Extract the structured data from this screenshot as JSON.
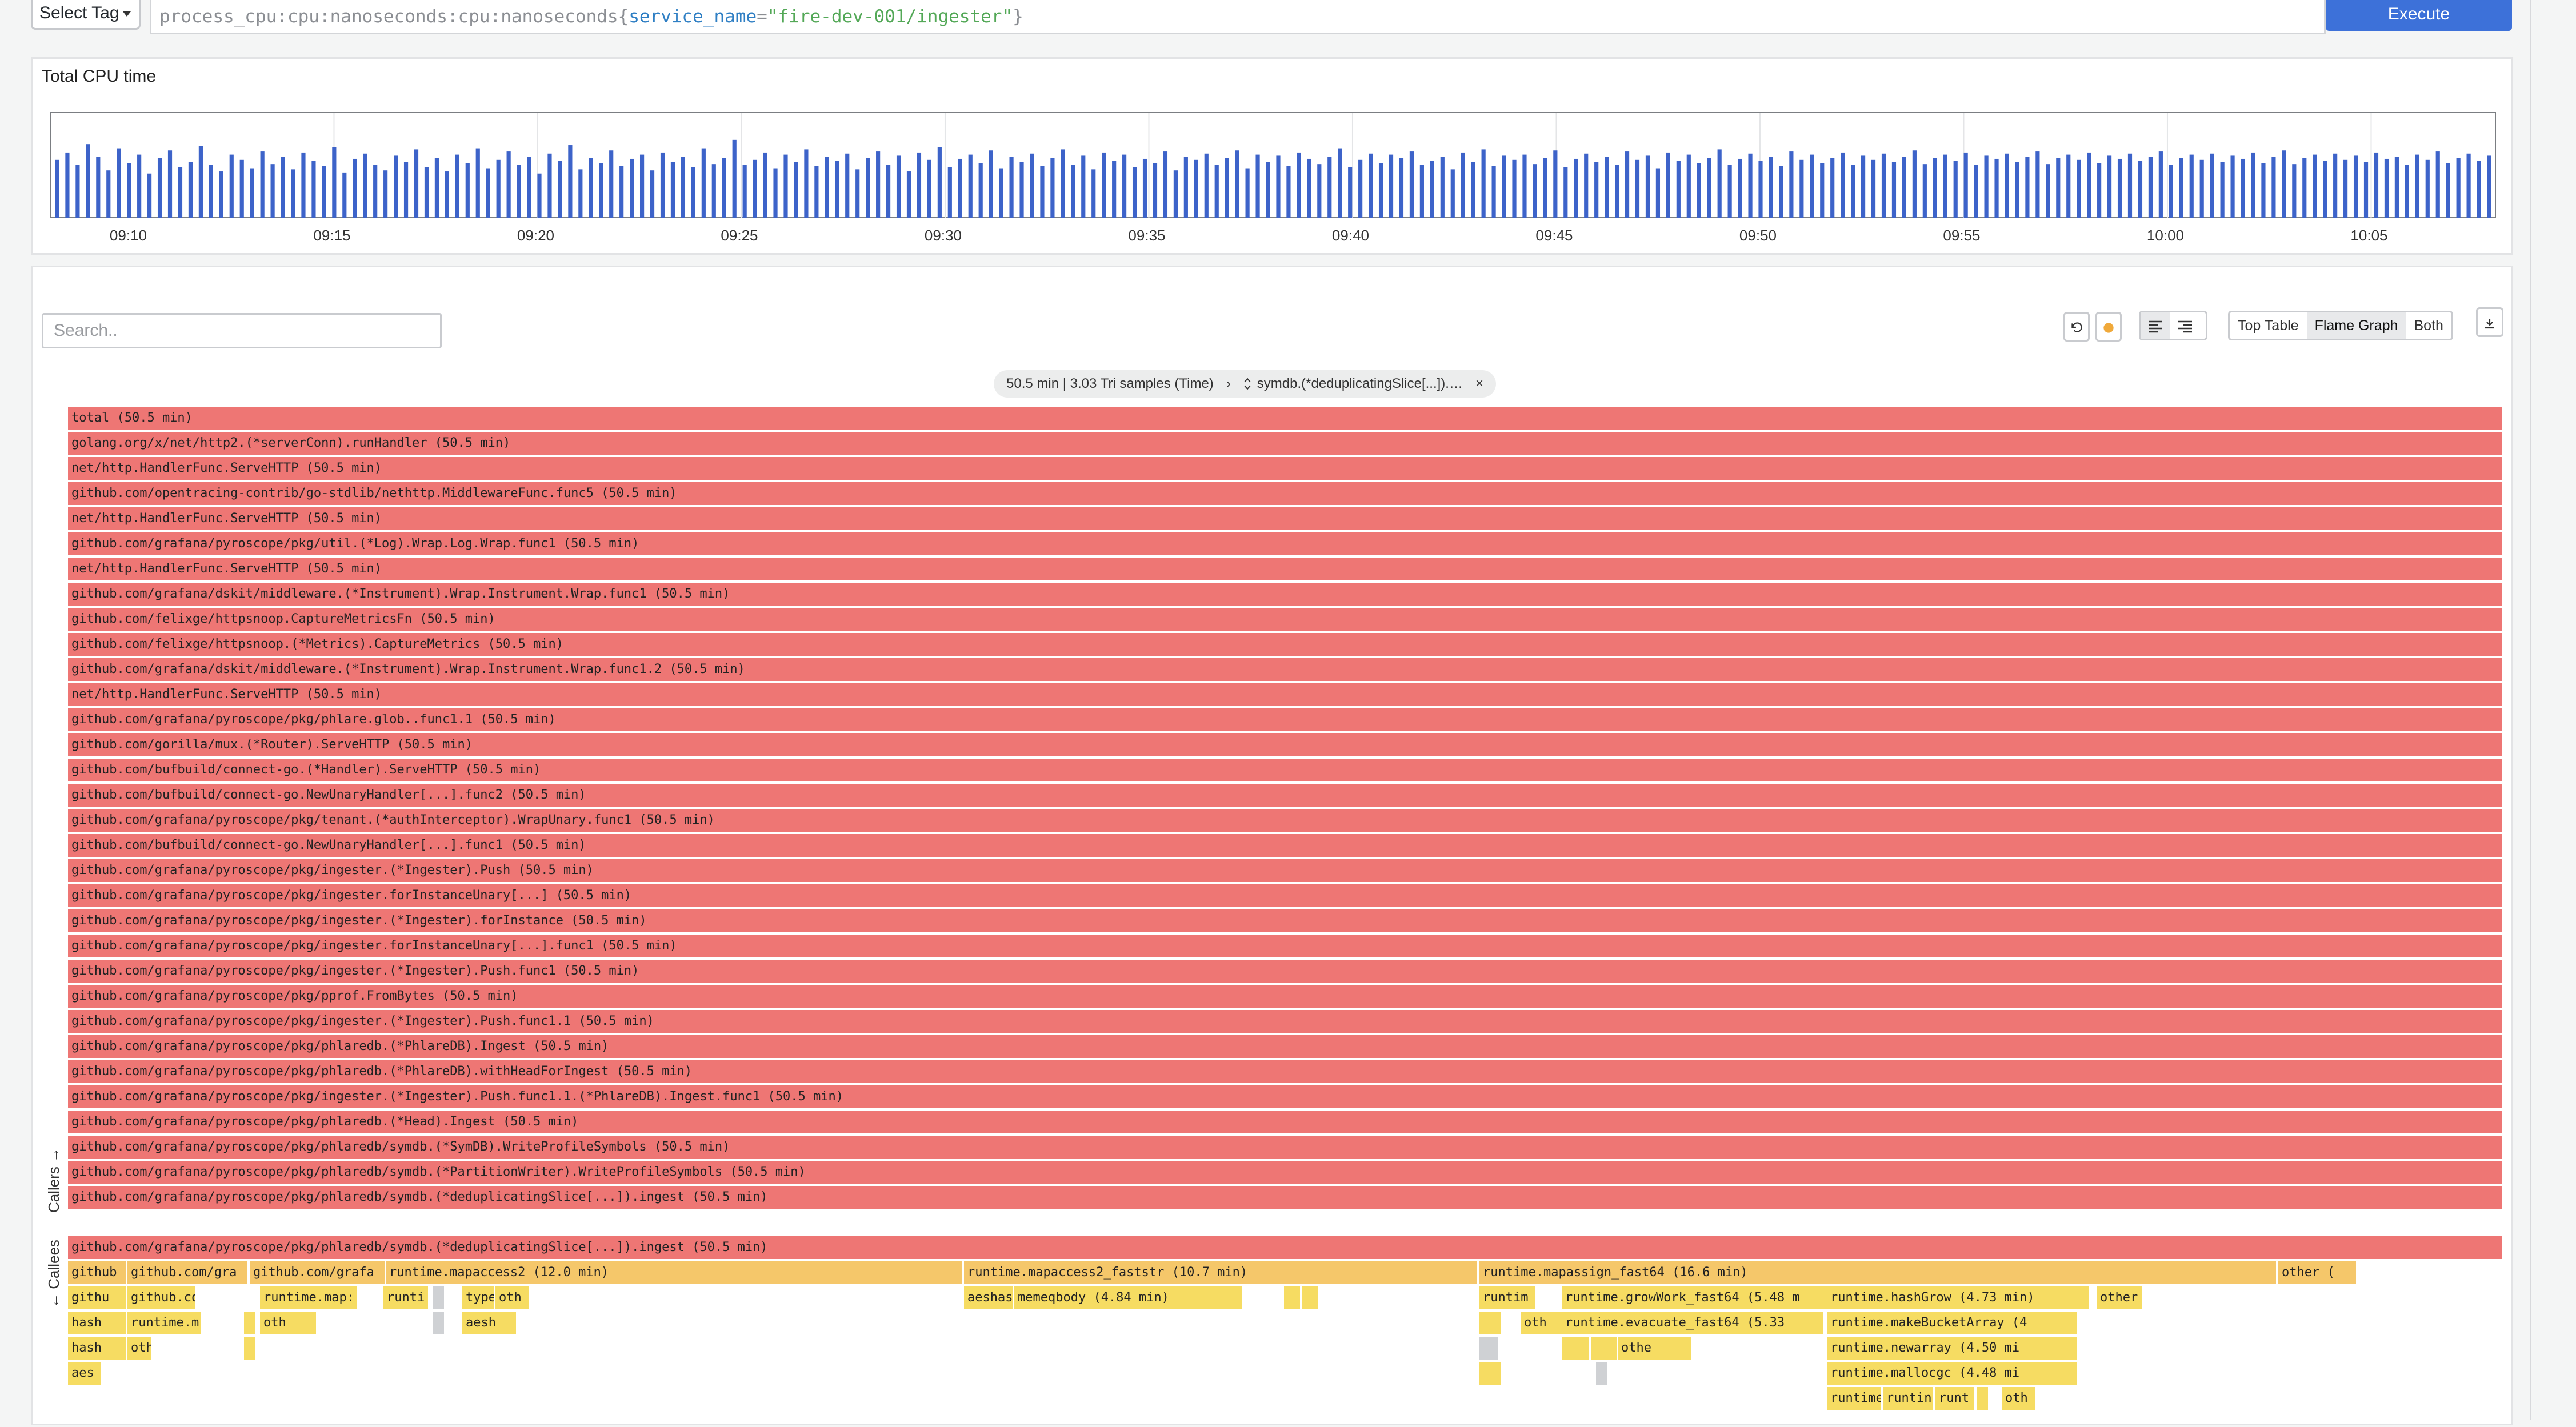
{
  "query": {
    "select_tag_label": "Select Tag",
    "metric": "process_cpu:cpu:nanoseconds:cpu:nanoseconds{",
    "label_name": "service_name",
    "operator": "=",
    "label_value": "\"fire-dev-001/ingester\"",
    "closing": "}",
    "execute_label": "Execute"
  },
  "timeline": {
    "title": "Total CPU time",
    "ticks": [
      "09:10",
      "09:15",
      "09:20",
      "09:25",
      "09:30",
      "09:35",
      "09:40",
      "09:45",
      "09:50",
      "09:55",
      "10:00",
      "10:05"
    ],
    "bar_color": "#3d63c9"
  },
  "chart_data": {
    "type": "bar",
    "title": "Total CPU time",
    "x_tick_labels": [
      "09:10",
      "09:15",
      "09:20",
      "09:25",
      "09:30",
      "09:35",
      "09:40",
      "09:45",
      "09:50",
      "09:55",
      "10:00",
      "10:05"
    ],
    "values": [
      0.55,
      0.62,
      0.5,
      0.7,
      0.58,
      0.45,
      0.66,
      0.52,
      0.6,
      0.42,
      0.57,
      0.64,
      0.48,
      0.53,
      0.68,
      0.5,
      0.44,
      0.6,
      0.55,
      0.47,
      0.63,
      0.51,
      0.58,
      0.46,
      0.62,
      0.54,
      0.49,
      0.67,
      0.43,
      0.56,
      0.61,
      0.5,
      0.45,
      0.59,
      0.53,
      0.65,
      0.48,
      0.57,
      0.44,
      0.6,
      0.52,
      0.66,
      0.47,
      0.55,
      0.63,
      0.5,
      0.58,
      0.42,
      0.61,
      0.54,
      0.69,
      0.46,
      0.57,
      0.52,
      0.64,
      0.49,
      0.56,
      0.6,
      0.45,
      0.62,
      0.53,
      0.58,
      0.48,
      0.66,
      0.51,
      0.57,
      0.74,
      0.5,
      0.55,
      0.62,
      0.47,
      0.6,
      0.53,
      0.65,
      0.49,
      0.58,
      0.54,
      0.61,
      0.46,
      0.57,
      0.63,
      0.5,
      0.59,
      0.44,
      0.62,
      0.55,
      0.67,
      0.48,
      0.56,
      0.6,
      0.52,
      0.64,
      0.47,
      0.58,
      0.53,
      0.61,
      0.49,
      0.57,
      0.65,
      0.5,
      0.59,
      0.46,
      0.62,
      0.54,
      0.6,
      0.48,
      0.56,
      0.52,
      0.63,
      0.45,
      0.58,
      0.55,
      0.61,
      0.5,
      0.57,
      0.64,
      0.47,
      0.6,
      0.53,
      0.59,
      0.49,
      0.62,
      0.56,
      0.51,
      0.58,
      0.66,
      0.48,
      0.55,
      0.61,
      0.52,
      0.6,
      0.57,
      0.63,
      0.5,
      0.54,
      0.58,
      0.46,
      0.62,
      0.53,
      0.65,
      0.49,
      0.59,
      0.55,
      0.6,
      0.51,
      0.57,
      0.64,
      0.48,
      0.56,
      0.61,
      0.53,
      0.58,
      0.5,
      0.63,
      0.55,
      0.59,
      0.47,
      0.62,
      0.54,
      0.6,
      0.52,
      0.57,
      0.65,
      0.5,
      0.56,
      0.61,
      0.54,
      0.58,
      0.49,
      0.63,
      0.55,
      0.6,
      0.52,
      0.57,
      0.62,
      0.5,
      0.59,
      0.55,
      0.61,
      0.53,
      0.58,
      0.64,
      0.51,
      0.57,
      0.6,
      0.54,
      0.62,
      0.5,
      0.59,
      0.56,
      0.61,
      0.53,
      0.58,
      0.63,
      0.51,
      0.57,
      0.6,
      0.55,
      0.62,
      0.52,
      0.59,
      0.56,
      0.61,
      0.54,
      0.58,
      0.63,
      0.5,
      0.57,
      0.6,
      0.55,
      0.61,
      0.53,
      0.59,
      0.56,
      0.62,
      0.52,
      0.58,
      0.64,
      0.51,
      0.57,
      0.6,
      0.54,
      0.61,
      0.55,
      0.59,
      0.53,
      0.62,
      0.56,
      0.58,
      0.5,
      0.6,
      0.55,
      0.63,
      0.52,
      0.57,
      0.61,
      0.54,
      0.59
    ],
    "ylim": [
      0,
      1
    ]
  },
  "toolbar": {
    "search_placeholder": "Search..",
    "views": [
      "Top Table",
      "Flame Graph",
      "Both"
    ],
    "active_view": "Flame Graph"
  },
  "breadcrumb": {
    "summary": "50.5 min | 3.03 Tri samples (Time)",
    "separator": "›",
    "selected": "symdb.(*deduplicatingSlice[...]).…",
    "close": "×"
  },
  "side_labels": {
    "callers": "Callers →",
    "callees": "← Callees"
  },
  "callers": [
    "total (50.5 min)",
    "golang.org/x/net/http2.(*serverConn).runHandler (50.5 min)",
    "net/http.HandlerFunc.ServeHTTP (50.5 min)",
    "github.com/opentracing-contrib/go-stdlib/nethttp.MiddlewareFunc.func5 (50.5 min)",
    "net/http.HandlerFunc.ServeHTTP (50.5 min)",
    "github.com/grafana/pyroscope/pkg/util.(*Log).Wrap.Log.Wrap.func1 (50.5 min)",
    "net/http.HandlerFunc.ServeHTTP (50.5 min)",
    "github.com/grafana/dskit/middleware.(*Instrument).Wrap.Instrument.Wrap.func1 (50.5 min)",
    "github.com/felixge/httpsnoop.CaptureMetricsFn (50.5 min)",
    "github.com/felixge/httpsnoop.(*Metrics).CaptureMetrics (50.5 min)",
    "github.com/grafana/dskit/middleware.(*Instrument).Wrap.Instrument.Wrap.func1.2 (50.5 min)",
    "net/http.HandlerFunc.ServeHTTP (50.5 min)",
    "github.com/grafana/pyroscope/pkg/phlare.glob..func1.1 (50.5 min)",
    "github.com/gorilla/mux.(*Router).ServeHTTP (50.5 min)",
    "github.com/bufbuild/connect-go.(*Handler).ServeHTTP (50.5 min)",
    "github.com/bufbuild/connect-go.NewUnaryHandler[...].func2 (50.5 min)",
    "github.com/grafana/pyroscope/pkg/tenant.(*authInterceptor).WrapUnary.func1 (50.5 min)",
    "github.com/bufbuild/connect-go.NewUnaryHandler[...].func1 (50.5 min)",
    "github.com/grafana/pyroscope/pkg/ingester.(*Ingester).Push (50.5 min)",
    "github.com/grafana/pyroscope/pkg/ingester.forInstanceUnary[...] (50.5 min)",
    "github.com/grafana/pyroscope/pkg/ingester.(*Ingester).forInstance (50.5 min)",
    "github.com/grafana/pyroscope/pkg/ingester.forInstanceUnary[...].func1 (50.5 min)",
    "github.com/grafana/pyroscope/pkg/ingester.(*Ingester).Push.func1 (50.5 min)",
    "github.com/grafana/pyroscope/pkg/pprof.FromBytes (50.5 min)",
    "github.com/grafana/pyroscope/pkg/ingester.(*Ingester).Push.func1.1 (50.5 min)",
    "github.com/grafana/pyroscope/pkg/phlaredb.(*PhlareDB).Ingest (50.5 min)",
    "github.com/grafana/pyroscope/pkg/phlaredb.(*PhlareDB).withHeadForIngest (50.5 min)",
    "github.com/grafana/pyroscope/pkg/ingester.(*Ingester).Push.func1.1.(*PhlareDB).Ingest.func1 (50.5 min)",
    "github.com/grafana/pyroscope/pkg/phlaredb.(*Head).Ingest (50.5 min)",
    "github.com/grafana/pyroscope/pkg/phlaredb/symdb.(*SymDB).WriteProfileSymbols (50.5 min)",
    "github.com/grafana/pyroscope/pkg/phlaredb/symdb.(*PartitionWriter).WriteProfileSymbols (50.5 min)",
    "github.com/grafana/pyroscope/pkg/phlaredb/symdb.(*deduplicatingSlice[...]).ingest (50.5 min)"
  ],
  "callee_root": "github.com/grafana/pyroscope/pkg/phlaredb/symdb.(*deduplicatingSlice[...]).ingest (50.5 min)",
  "callees": {
    "row1": [
      "github",
      "github.com/gra",
      "github.com/grafa",
      "runtime.mapaccess2 (12.0 min)",
      "runtime.mapaccess2_faststr (10.7 min)",
      "runtime.mapassign_fast64 (16.6 min)",
      "other ("
    ],
    "row2": [
      "githu",
      "github.com/(",
      "runtime.map:",
      "runti",
      "type:",
      "oth",
      "aeshas",
      "memeqbody (4.84 min)",
      "runtim",
      "runtime.growWork_fast64 (5.48 m",
      "runtime.hashGrow (4.73 min)",
      "other"
    ],
    "row3": [
      "hash",
      "runtime.m",
      "oth",
      "aesh",
      "oth",
      "runtime.evacuate_fast64 (5.33",
      "runtime.makeBucketArray (4"
    ],
    "row4": [
      "hash",
      "oth",
      "othe",
      "runtime.newarray (4.50 mi"
    ],
    "row5": [
      "aes",
      "runtime.mallocgc (4.48 mi"
    ],
    "row6": [
      "runtime",
      "runtin",
      "runt",
      "oth"
    ]
  },
  "colors": {
    "callers": "#ee7674",
    "callees_root": "#ee7674",
    "callees_orange": "#f5c76a",
    "callees_yellow": "#f6dc62",
    "accent": "#3d71d9"
  }
}
